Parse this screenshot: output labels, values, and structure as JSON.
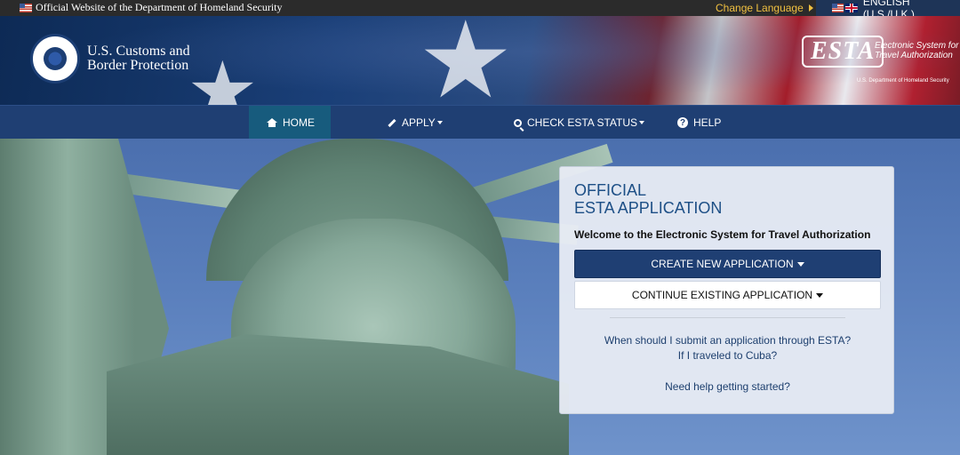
{
  "topbar": {
    "official_text": "Official Website of the Department of Homeland Security",
    "change_language": "Change Language",
    "language": "ENGLISH (U.S./U.K.)"
  },
  "header": {
    "agency_line1": "U.S. Customs and",
    "agency_line2": "Border Protection",
    "esta_logo_text": "ESTA",
    "esta_subtitle": "Electronic System for Travel Authorization",
    "esta_dhs_text": "U.S. Department of Homeland Security"
  },
  "nav": {
    "home": "HOME",
    "apply": "APPLY",
    "check_status": "CHECK ESTA STATUS",
    "help": "HELP"
  },
  "panel": {
    "title_line1": "OFFICIAL",
    "title_line2": "ESTA APPLICATION",
    "welcome": "Welcome to the Electronic System for Travel Authorization",
    "create_button": "CREATE NEW APPLICATION",
    "continue_button": "CONTINUE EXISTING APPLICATION",
    "link_when": "When should I submit an application through ESTA?",
    "link_cuba": "If I traveled to Cuba?",
    "link_help": "Need help getting started?"
  },
  "colors": {
    "nav_bg": "#1f3f73",
    "nav_active": "#175b7d",
    "primary_button": "#1f3f73",
    "link": "#1d3f6e",
    "title": "#1d4f86",
    "change_language": "#f0c040"
  }
}
